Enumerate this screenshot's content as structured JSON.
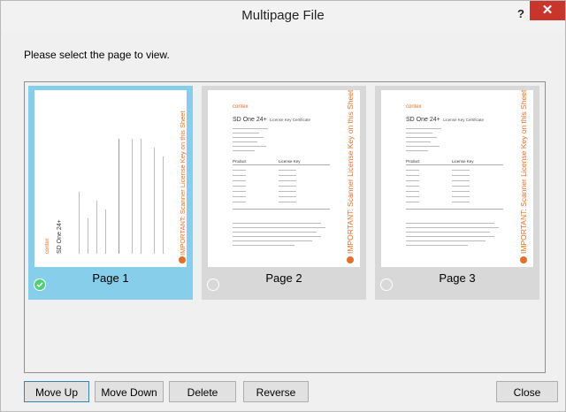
{
  "window": {
    "title": "Multipage File",
    "help_label": "?",
    "close_label": "✕"
  },
  "prompt": "Please select the page to view.",
  "pages": [
    {
      "label": "Page 1",
      "selected": true
    },
    {
      "label": "Page 2",
      "selected": false
    },
    {
      "label": "Page 3",
      "selected": false
    }
  ],
  "thumbnail": {
    "logo": "contex",
    "heading": "SD One 24+",
    "subheading": "License Key Certificate",
    "banner": "IMPORTANT: Scanner License Key on this Sheet",
    "col_product": "Product",
    "col_key": "License Key"
  },
  "buttons": {
    "move_up": "Move Up",
    "move_down": "Move Down",
    "delete": "Delete",
    "reverse": "Reverse",
    "close": "Close"
  },
  "colors": {
    "selected_tile": "#87ceeb",
    "tile": "#d8d8d8",
    "accent_orange": "#e2702b",
    "close_red": "#c7352b"
  }
}
